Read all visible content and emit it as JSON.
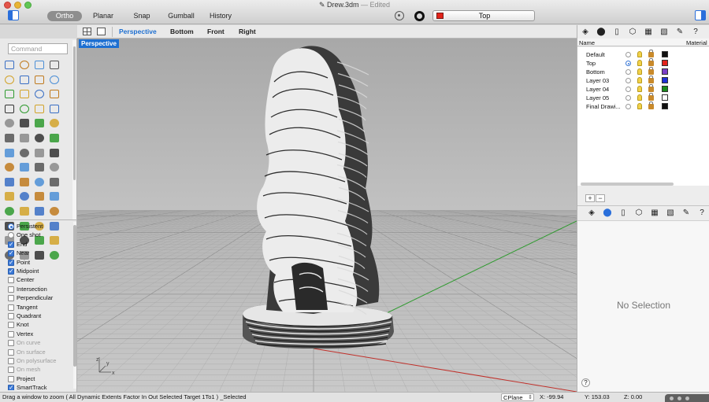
{
  "window": {
    "title_file": "Drew.3dm",
    "title_sep": " — ",
    "title_state": "Edited",
    "file_icon": "document-icon"
  },
  "toolbar": {
    "modes": [
      "Ortho",
      "Planar",
      "Snap",
      "Gumball",
      "History"
    ],
    "active_mode": "Ortho",
    "current_layer": "Top",
    "current_layer_color": "#e2231a"
  },
  "viewport_tabs": {
    "tabs": [
      "Perspective",
      "Bottom",
      "Front",
      "Right"
    ],
    "active": "Perspective",
    "accent_color": "#1d6fd1"
  },
  "viewport": {
    "label": "Perspective",
    "axis_labels": {
      "z": "z",
      "x": "x",
      "y": "y"
    },
    "x_axis_color": "#c0302a",
    "y_axis_color": "#2f9a2f"
  },
  "command": {
    "placeholder": "Command"
  },
  "osnaps": {
    "items": [
      {
        "label": "Persistent",
        "kind": "radio",
        "checked": true,
        "enabled": true
      },
      {
        "label": "One shot",
        "kind": "radio",
        "checked": false,
        "enabled": true
      },
      {
        "label": "End",
        "kind": "check",
        "checked": true,
        "enabled": true
      },
      {
        "label": "Near",
        "kind": "check",
        "checked": true,
        "enabled": true
      },
      {
        "label": "Point",
        "kind": "check",
        "checked": true,
        "enabled": true
      },
      {
        "label": "Midpoint",
        "kind": "check",
        "checked": true,
        "enabled": true
      },
      {
        "label": "Center",
        "kind": "check",
        "checked": false,
        "enabled": true
      },
      {
        "label": "Intersection",
        "kind": "check",
        "checked": false,
        "enabled": true
      },
      {
        "label": "Perpendicular",
        "kind": "check",
        "checked": false,
        "enabled": true
      },
      {
        "label": "Tangent",
        "kind": "check",
        "checked": false,
        "enabled": true
      },
      {
        "label": "Quadrant",
        "kind": "check",
        "checked": false,
        "enabled": true
      },
      {
        "label": "Knot",
        "kind": "check",
        "checked": false,
        "enabled": true
      },
      {
        "label": "Vertex",
        "kind": "check",
        "checked": false,
        "enabled": true
      },
      {
        "label": "On curve",
        "kind": "check",
        "checked": false,
        "enabled": false
      },
      {
        "label": "On surface",
        "kind": "check",
        "checked": false,
        "enabled": false
      },
      {
        "label": "On polysurface",
        "kind": "check",
        "checked": false,
        "enabled": false
      },
      {
        "label": "On mesh",
        "kind": "check",
        "checked": false,
        "enabled": false
      },
      {
        "label": "Project",
        "kind": "check",
        "checked": false,
        "enabled": true
      },
      {
        "label": "SmartTrack",
        "kind": "check",
        "checked": true,
        "enabled": true
      }
    ]
  },
  "layers": {
    "columns": {
      "name": "Name",
      "material": "Material"
    },
    "rows": [
      {
        "name": "Default",
        "current": false,
        "color": "#111111"
      },
      {
        "name": "Top",
        "current": true,
        "color": "#e2231a"
      },
      {
        "name": "Bottom",
        "current": false,
        "color": "#7b3fc7"
      },
      {
        "name": "Layer 03",
        "current": false,
        "color": "#1f2fd6"
      },
      {
        "name": "Layer 04",
        "current": false,
        "color": "#1b8a1b"
      },
      {
        "name": "Layer 05",
        "current": false,
        "color": "#ffffff"
      },
      {
        "name": "Final Drawi...",
        "current": false,
        "color": "#111111"
      }
    ],
    "add_label": "+",
    "remove_label": "−"
  },
  "properties": {
    "empty_text": "No Selection",
    "help_label": "?"
  },
  "statusbar": {
    "prompt": "Drag a window to zoom ( All Dynamic Extents Factor In Out Selected Target 1To1 ) _Selected",
    "cplane": "CPlane",
    "x": "X: -99.94",
    "y": "Y: 153.03",
    "z": "Z: 0.00"
  }
}
